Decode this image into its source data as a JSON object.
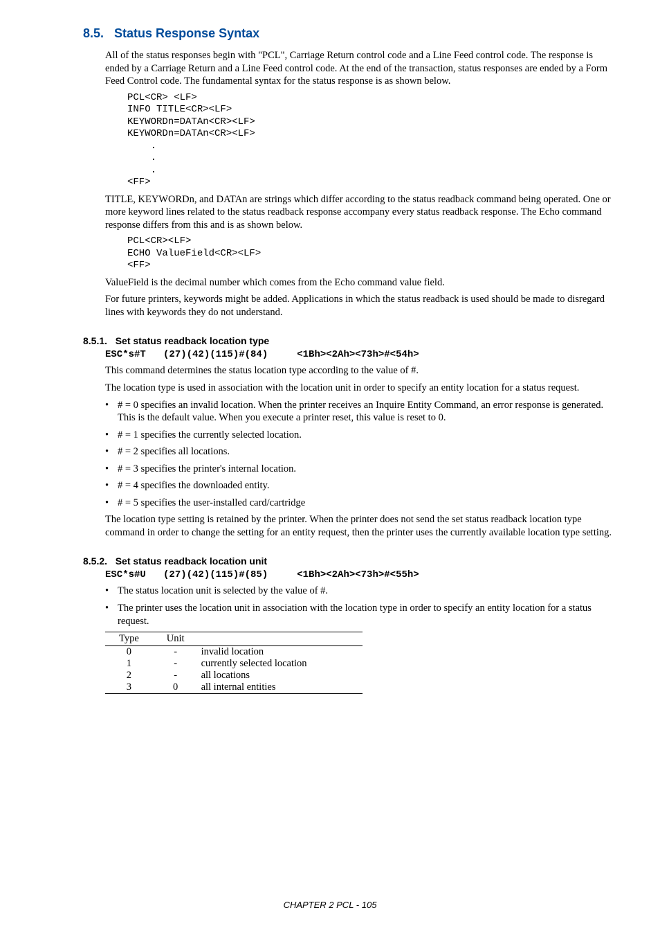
{
  "section": {
    "number": "8.5.",
    "title": "Status Response Syntax",
    "intro": "All of the status responses begin with \"PCL\", Carriage Return control code and a Line Feed control code. The response is ended by a Carriage Return and a Line Feed control code. At the end of the transaction, status responses are ended by a Form Feed Control code. The fundamental syntax for the status response is as shown below.",
    "code1": "PCL<CR> <LF>\nINFO TITLE<CR><LF>\nKEYWORDn=DATAn<CR><LF>\nKEYWORDn=DATAn<CR><LF>\n    .\n    .\n    .\n<FF>",
    "para2": "TITLE, KEYWORDn, and DATAn are strings which differ according to the  status readback command being operated. One or more keyword lines related to the status readback response accompany every status readback response. The Echo command response differs from this and is as shown below.",
    "code2": "PCL<CR><LF>\nECHO ValueField<CR><LF>\n<FF>",
    "para3": "ValueField is the decimal number which comes from the Echo command value field.",
    "para4": "For future printers, keywords might be added. Applications in which the status readback is used should be made to disregard lines with keywords they do not understand."
  },
  "s851": {
    "number": "8.5.1.",
    "title": "Set status readback location type",
    "esc": "ESC*s#T   (27)(42)(115)#(84)     <1Bh><2Ah><73h>#<54h>",
    "p1": "This command determines the status location type according to the value of #.",
    "p2": "The location type is used in association with the location unit in order to specify an entity  location for a status request.",
    "bullets": [
      "# = 0 specifies an invalid location.  When the printer receives an Inquire Entity Command,  an error response is generated.  This is the default value.  When you execute a printer reset,  this value is reset to 0.",
      "# = 1 specifies the currently selected location.",
      "# = 2 specifies all locations.",
      "# = 3 specifies the printer's internal location.",
      "# = 4 specifies the downloaded entity.",
      "# = 5 specifies the user-installed card/cartridge"
    ],
    "p3": "The location type setting is retained by the printer. When the printer does not send the set status readback location type command in order to change the setting for an entity request, then the printer uses the currently available location type setting."
  },
  "s852": {
    "number": "8.5.2.",
    "title": "Set status readback location unit",
    "esc": "ESC*s#U   (27)(42)(115)#(85)     <1Bh><2Ah><73h>#<55h>",
    "bullets": [
      "The status location unit is selected by the value of #.",
      "The printer uses the location unit in association with the location type in order to specify an entity location for a status request."
    ],
    "table": {
      "head": {
        "c1": "Type",
        "c2": "Unit",
        "c3": ""
      },
      "rows": [
        {
          "c1": "0",
          "c2": "-",
          "c3": "invalid location"
        },
        {
          "c1": "1",
          "c2": "-",
          "c3": "currently selected location"
        },
        {
          "c1": "2",
          "c2": "-",
          "c3": "all locations"
        },
        {
          "c1": "3",
          "c2": "0",
          "c3": "all internal entities"
        }
      ]
    }
  },
  "footer": "CHAPTER 2 PCL - 105"
}
